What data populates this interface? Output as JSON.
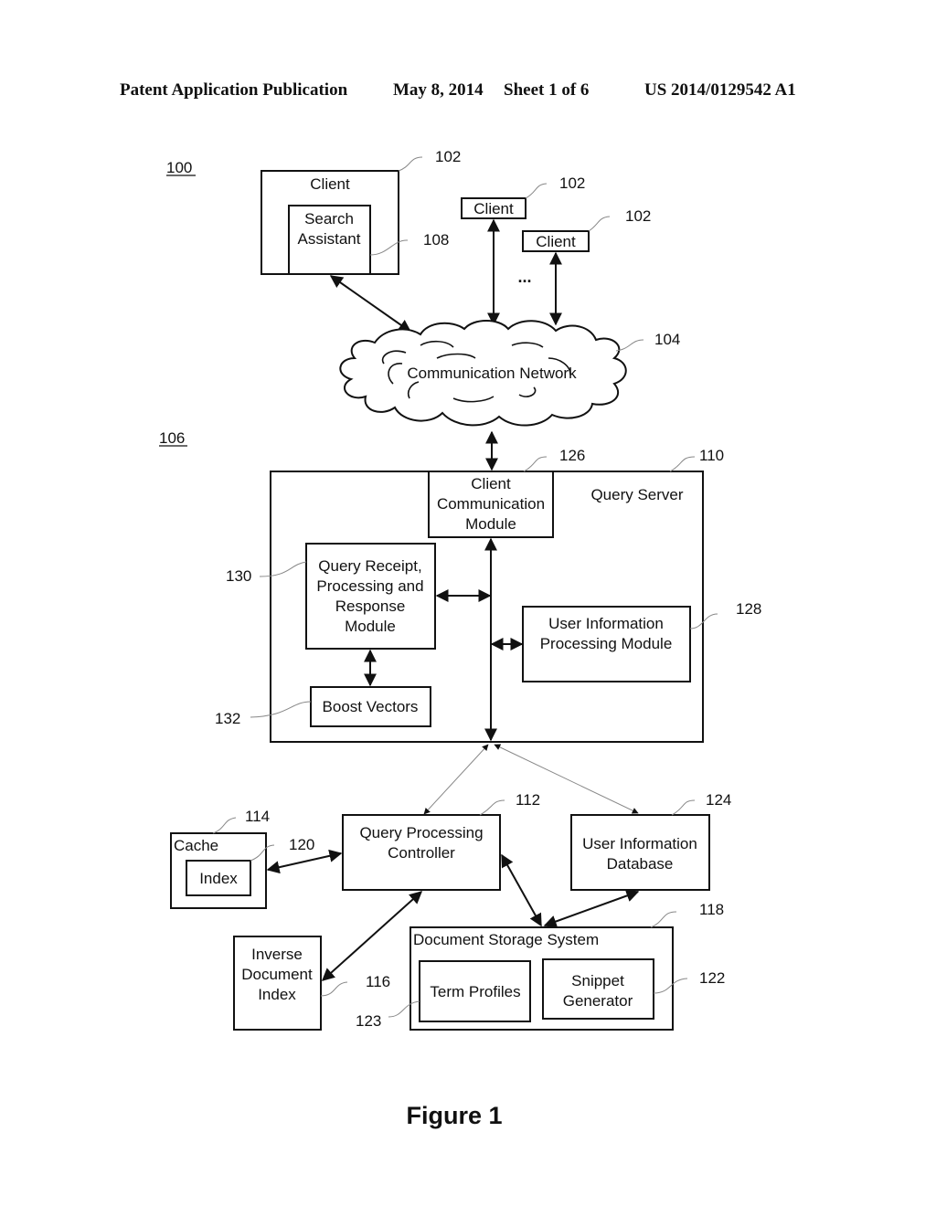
{
  "header": {
    "publication": "Patent Application Publication",
    "date": "May 8, 2014",
    "sheet": "Sheet 1 of 6",
    "number": "US 2014/0129542 A1"
  },
  "diagram": {
    "system_ref": "100",
    "server_system_ref": "106",
    "clients": [
      {
        "label": "Client",
        "ref": "102",
        "inner": {
          "line1": "Search",
          "line2": "Assistant",
          "ref": "108"
        }
      },
      {
        "label": "Client",
        "ref": "102"
      },
      {
        "label": "Client",
        "ref": "102"
      }
    ],
    "ellipsis": "...",
    "network": {
      "label": "Communication Network",
      "ref": "104"
    },
    "query_server": {
      "label": "Query Server",
      "ref": "110",
      "client_comm": {
        "line1": "Client",
        "line2": "Communication",
        "line3": "Module",
        "ref": "126"
      },
      "query_receipt": {
        "line1": "Query Receipt,",
        "line2": "Processing and",
        "line3": "Response",
        "line4": "Module",
        "ref": "130"
      },
      "user_info_proc": {
        "line1": "User Information",
        "line2": "Processing Module",
        "ref": "128"
      },
      "boost_vectors": {
        "label": "Boost Vectors",
        "ref": "132"
      }
    },
    "cache": {
      "label": "Cache",
      "ref": "114",
      "index": {
        "label": "Index",
        "ref": "120"
      }
    },
    "query_controller": {
      "line1": "Query Processing",
      "line2": "Controller",
      "ref": "112"
    },
    "user_info_db": {
      "line1": "User Information",
      "line2": "Database",
      "ref": "124"
    },
    "inverse_index": {
      "line1": "Inverse",
      "line2": "Document",
      "line3": "Index",
      "ref": "116"
    },
    "doc_storage": {
      "label": "Document Storage System",
      "ref": "118",
      "term_profiles": {
        "label": "Term Profiles",
        "ref": "123"
      },
      "snippet": {
        "line1": "Snippet",
        "line2": "Generator",
        "ref": "122"
      }
    }
  },
  "figure_caption": "Figure 1"
}
